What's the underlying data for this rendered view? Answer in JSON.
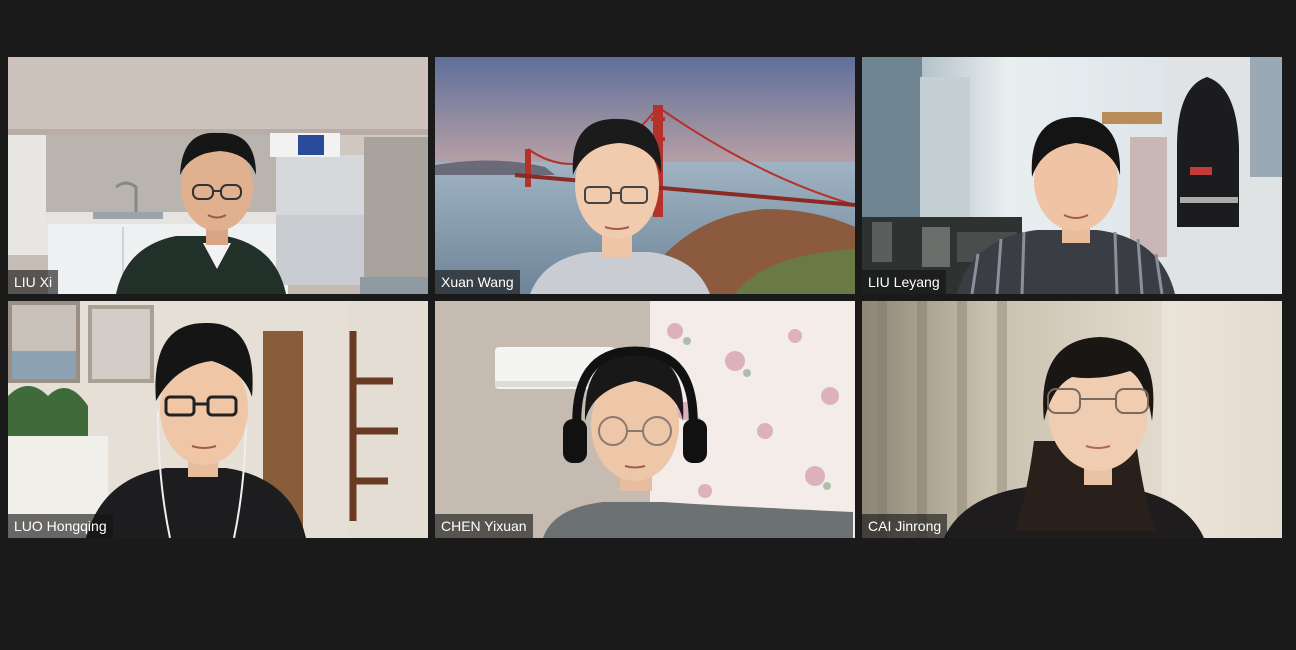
{
  "participants": [
    {
      "name": "LIU Xi",
      "background": "kitchen"
    },
    {
      "name": "Xuan Wang",
      "background": "golden-gate-bridge-sunset"
    },
    {
      "name": "LIU Leyang",
      "background": "bedroom-with-backpack"
    },
    {
      "name": "LUO Hongqing",
      "background": "room-with-coat-rack"
    },
    {
      "name": "CHEN Yixuan",
      "background": "room-with-floral-curtain"
    },
    {
      "name": "CAI Jinrong",
      "background": "blurred-curtain"
    }
  ],
  "colors": {
    "window_background": "#1a1a1a",
    "name_tag_background": "rgba(20,20,20,0.62)",
    "name_tag_text": "#ffffff"
  }
}
